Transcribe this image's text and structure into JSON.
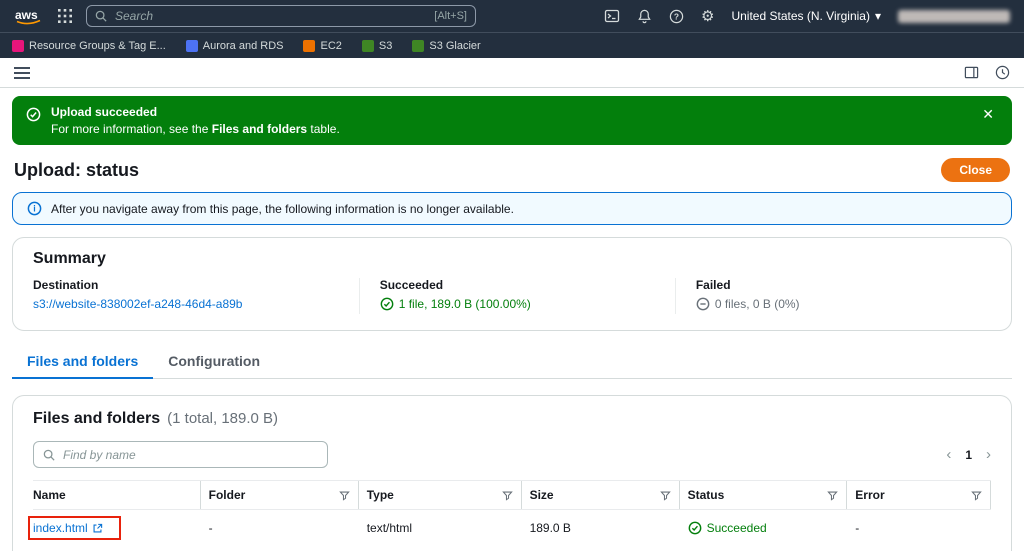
{
  "icons": {
    "close": "✕",
    "gear": "⚙",
    "chevron_down": "▾",
    "chevron_left": "‹",
    "chevron_right": "›"
  },
  "topnav": {
    "search": {
      "placeholder": "Search",
      "shortcut": "[Alt+S]"
    },
    "region_label": "United States (N. Virginia)"
  },
  "favorites": {
    "items": [
      {
        "label": "Resource Groups & Tag E...",
        "color": "#e7157b"
      },
      {
        "label": "Aurora and RDS",
        "color": "#4d72f3"
      },
      {
        "label": "EC2",
        "color": "#ed7100"
      },
      {
        "label": "S3",
        "color": "#3f8624"
      },
      {
        "label": "S3 Glacier",
        "color": "#3f8624"
      }
    ]
  },
  "flashbar": {
    "title": "Upload succeeded",
    "message_prefix": "For more information, see the ",
    "message_link": "Files and folders",
    "message_suffix": " table."
  },
  "header": {
    "title": "Upload: status",
    "close_button": "Close"
  },
  "alert": {
    "text": "After you navigate away from this page, the following information is no longer available."
  },
  "summary": {
    "heading": "Summary",
    "columns": [
      {
        "label": "Destination",
        "value": "s3://website-838002ef-a248-46d4-a89b"
      },
      {
        "label": "Succeeded",
        "value": "1 file, 189.0 B (100.00%)"
      },
      {
        "label": "Failed",
        "value": "0 files, 0 B (0%)"
      }
    ]
  },
  "tabs": [
    {
      "label": "Files and folders"
    },
    {
      "label": "Configuration"
    }
  ],
  "files_card": {
    "title": "Files and folders",
    "count": "(1 total, 189.0 B)",
    "filter_placeholder": "Find by name",
    "pagination": {
      "page": "1"
    },
    "columns": [
      {
        "label": "Name"
      },
      {
        "label": "Folder"
      },
      {
        "label": "Type"
      },
      {
        "label": "Size"
      },
      {
        "label": "Status"
      },
      {
        "label": "Error"
      }
    ],
    "rows": [
      {
        "name": "index.html",
        "folder": "-",
        "type": "text/html",
        "size": "189.0 B",
        "status": "Succeeded",
        "error": "-"
      }
    ]
  },
  "colors": {
    "success": "#037f0c",
    "link": "#0972d3",
    "primary_button": "#ec7211",
    "annotation": "#e8220c"
  }
}
